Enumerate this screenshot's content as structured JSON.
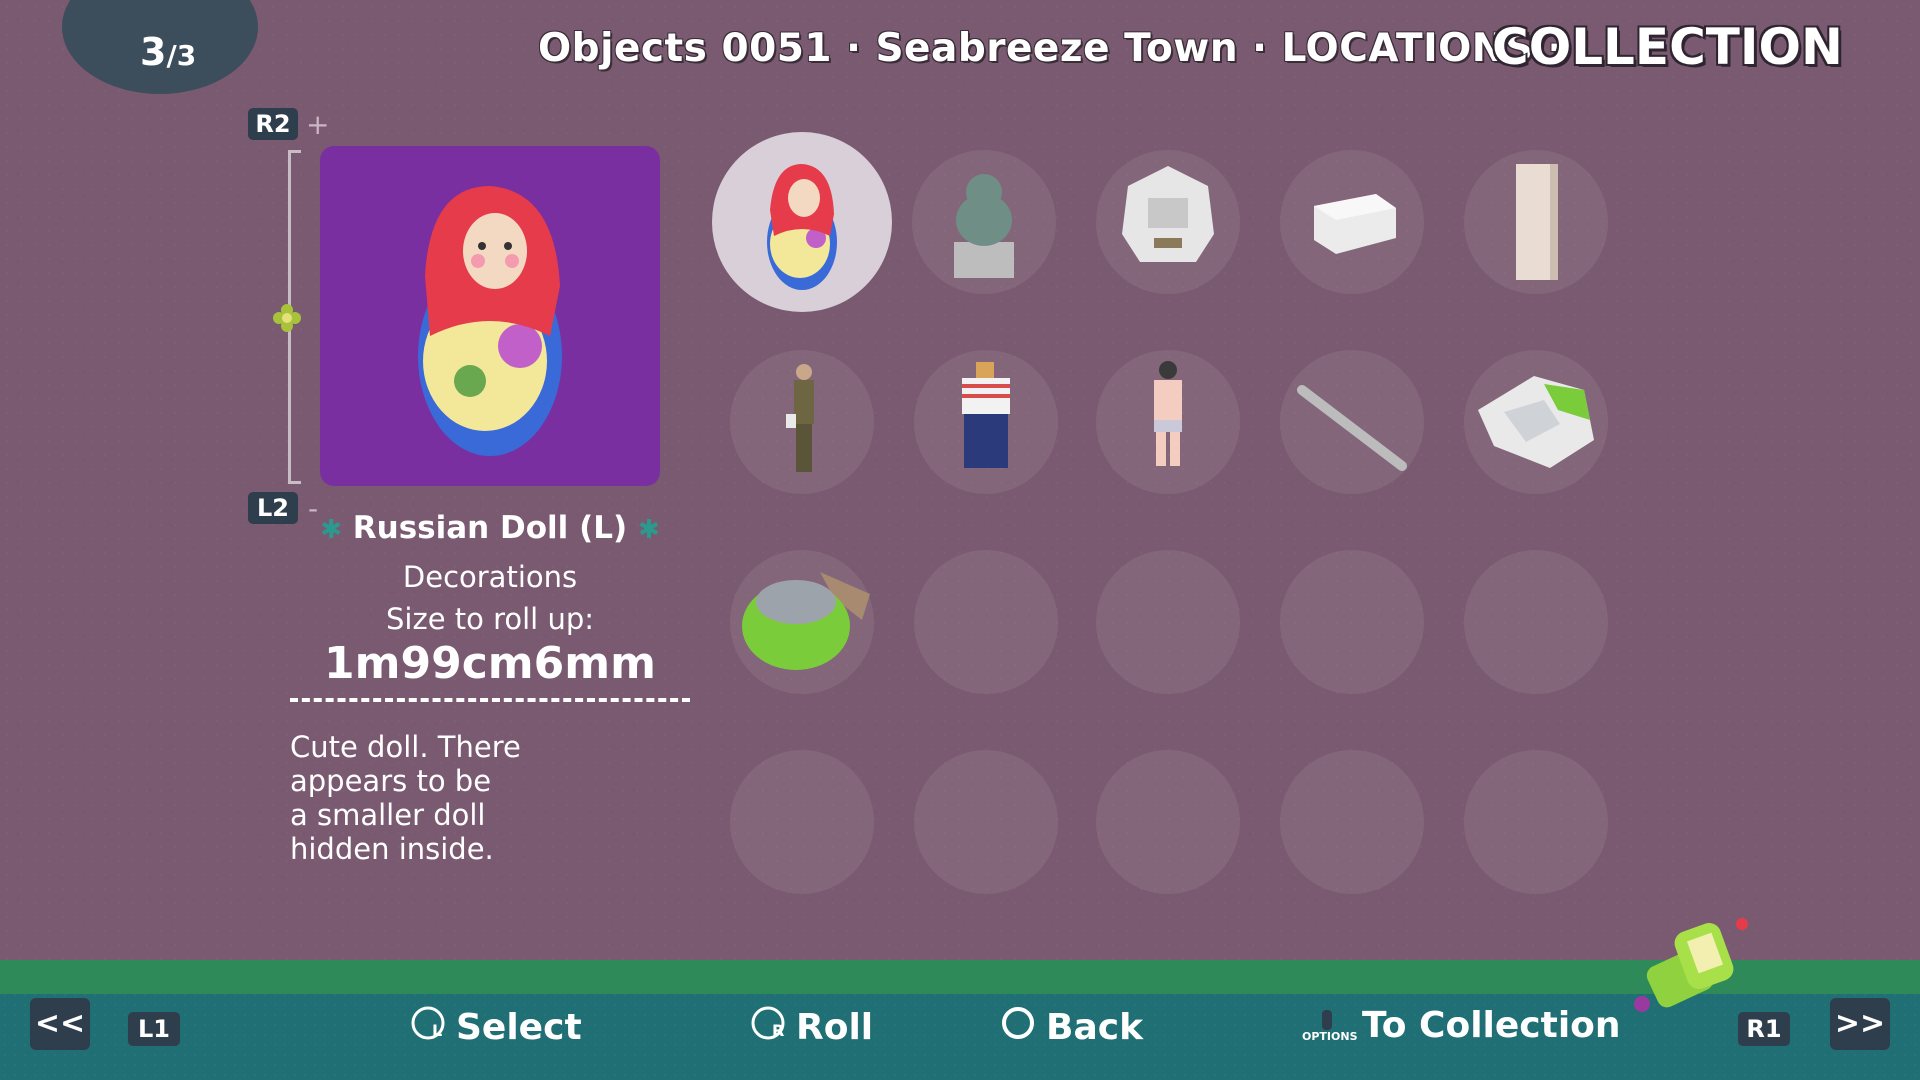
{
  "page": {
    "current": "3",
    "separator": "/",
    "total": "3"
  },
  "header": {
    "breadcrumb": "Objects 0051 · Seabreeze Town · LOCATIONS ·",
    "title": "COLLECTION"
  },
  "zoom": {
    "in_button": "R2",
    "out_button": "L2",
    "plus": "+",
    "minus": "-"
  },
  "selected_object": {
    "name": "Russian Doll (L)",
    "category": "Decorations",
    "size_label": "Size to roll up:",
    "size_value": "1m99cm6mm",
    "description_lines": [
      "Cute doll. There",
      "appears to be",
      "a smaller doll",
      "hidden inside."
    ]
  },
  "grid": {
    "items": [
      {
        "name": "russian-doll",
        "selected": true
      },
      {
        "name": "lion-statue"
      },
      {
        "name": "lion-head"
      },
      {
        "name": "white-box"
      },
      {
        "name": "tall-cabinet"
      },
      {
        "name": "man-with-bag"
      },
      {
        "name": "striped-shirt-person"
      },
      {
        "name": "swimmer"
      },
      {
        "name": "metal-pole"
      },
      {
        "name": "park-piece"
      },
      {
        "name": "green-island"
      },
      {
        "name": "empty"
      },
      {
        "name": "empty"
      },
      {
        "name": "empty"
      },
      {
        "name": "empty"
      },
      {
        "name": "empty"
      },
      {
        "name": "empty"
      },
      {
        "name": "empty"
      },
      {
        "name": "empty"
      },
      {
        "name": "empty"
      }
    ]
  },
  "footer": {
    "prev": "<<",
    "next": ">>",
    "l1": "L1",
    "r1": "R1",
    "select": "Select",
    "roll": "Roll",
    "back": "Back",
    "options_tag": "OPTIONS",
    "to_collection": "To Collection",
    "stick_l": "L",
    "stick_r": "R"
  },
  "colors": {
    "background": "#7a5a70",
    "preview": "#7a2fa0",
    "bar": "#1f6f74",
    "tag": "#2f3e4c"
  }
}
